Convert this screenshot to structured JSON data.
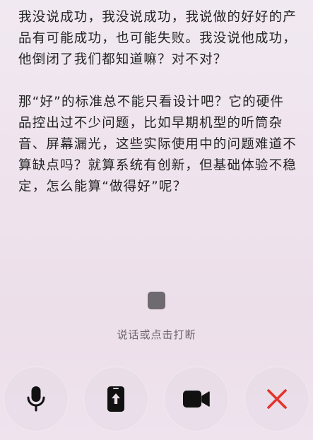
{
  "transcript": {
    "paragraphs": [
      "我没说成功，我没说成功，我说做的好好的产品有可能成功，也可能失败。我没说他成功，他倒闭了我们都知道嘛？对不对？",
      "那“好”的标准总不能只看设计吧？它的硬件品控出过不少问题，比如早期机型的听筒杂音、屏幕漏光，这些实际使用中的问题难道不算缺点吗？就算系统有创新，但基础体验不稳定，怎么能算“做得好”呢？"
    ]
  },
  "status": {
    "hint": "说话或点击打断"
  },
  "controls": {
    "icons": [
      "microphone-icon",
      "share-screen-icon",
      "video-camera-icon",
      "close-icon"
    ],
    "colors": {
      "icon": "#111111",
      "close": "#e2352d",
      "button_bg": "#e8dee8"
    }
  }
}
